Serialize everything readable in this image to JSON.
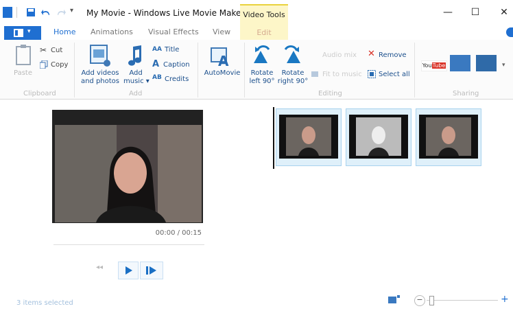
{
  "window": {
    "title": "My Movie - Windows Live Movie Maker",
    "context_tab": "Video Tools",
    "controls": [
      "—",
      "☐",
      "✕"
    ]
  },
  "tabs": {
    "home": "Home",
    "animations": "Animations",
    "visual_effects": "Visual Effects",
    "view": "View",
    "edit": "Edit"
  },
  "ribbon": {
    "clipboard": {
      "paste": "Paste",
      "cut": "Cut",
      "copy": "Copy",
      "group": "Clipboard"
    },
    "add": {
      "add_videos_line1": "Add videos",
      "add_videos_line2": "and photos",
      "add_music_line1": "Add",
      "add_music_line2": "music",
      "title": "Title",
      "caption": "Caption",
      "credits": "Credits",
      "group": "Add"
    },
    "automovie": "AutoMovie",
    "editing": {
      "rotate_left_line1": "Rotate",
      "rotate_left_line2": "left 90°",
      "rotate_right_line1": "Rotate",
      "rotate_right_line2": "right 90°",
      "audio_mix": "Audio mix",
      "fit_to_music": "Fit to music",
      "remove": "Remove",
      "select_all": "Select all",
      "group": "Editing"
    },
    "sharing": {
      "group": "Sharing",
      "youtube": "You Tube"
    }
  },
  "preview": {
    "time": "00:00 / 00:15"
  },
  "status": {
    "text": "3 items selected"
  },
  "colors": {
    "accent": "#1f6fd1",
    "context_tab": "#fdf6c8",
    "icon_blue": "#1a78c2"
  }
}
